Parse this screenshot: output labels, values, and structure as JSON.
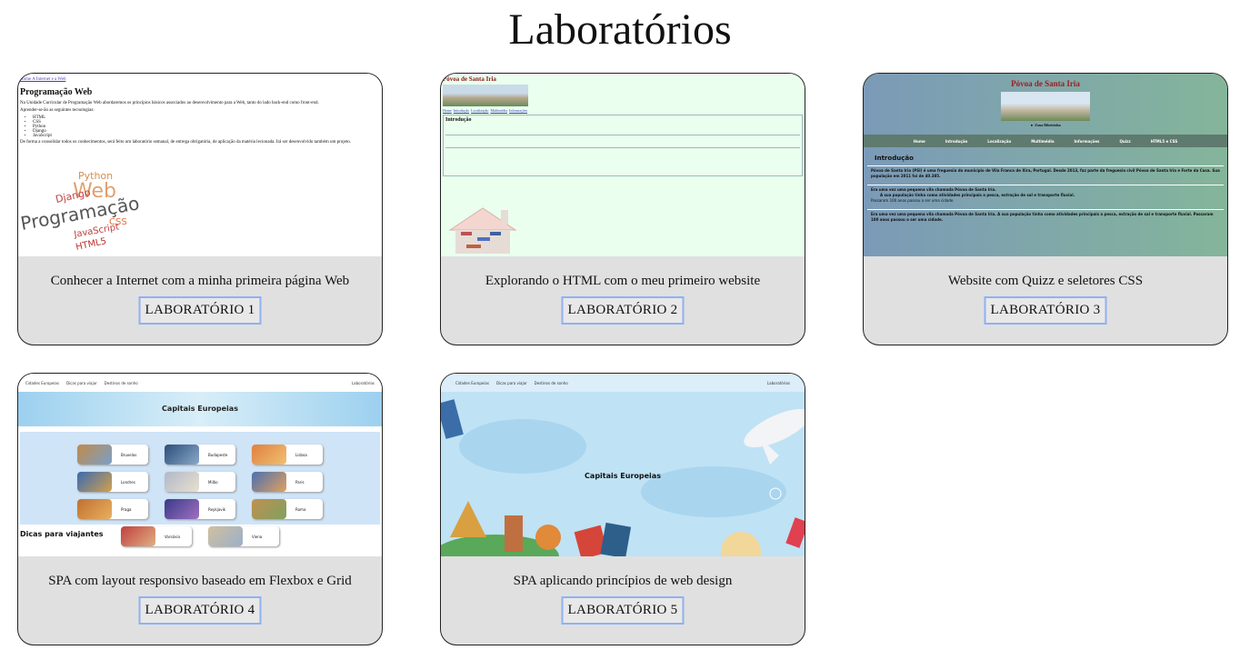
{
  "page": {
    "title": "Laboratórios"
  },
  "labs": [
    {
      "caption": "Conhecer a Internet com a minha primeira página Web",
      "button": "LABORATÓRIO 1",
      "preview": {
        "top_link": "Home A Internet e a Web",
        "heading": "Programação Web",
        "intro": "Na Unidade Curricular de Programação Web abordaremos os princípios básicos associados ao desenvolvimento para a Web, tanto do lado back-end como front-end.",
        "subintro": "Aprender-se-ão as seguintes tecnologias:",
        "items": [
          "HTML",
          "CSS",
          "Python",
          "Django",
          "JavaScript"
        ],
        "outro": "De forma a consolidar todos os conhecimentos, será feito um laboratório semanal, de entrega obrigatória, de aplicação da matéria lecionada. Irá ser desenvolvido também um projeto.",
        "cloud_words": [
          "Python",
          "Web",
          "Django",
          "Programação",
          "CSS",
          "JavaScript",
          "HTML5"
        ]
      }
    },
    {
      "caption": "Explorando o HTML com o meu primeiro website",
      "button": "LABORATÓRIO 2",
      "preview": {
        "heading": "Póvoa de Santa Iria",
        "nav": [
          "Home",
          "Introdução",
          "Localização",
          "Multimédia",
          "Informações"
        ],
        "section": "Introdução"
      }
    },
    {
      "caption": "Website com Quizz e seletores CSS",
      "button": "LABORATÓRIO 3",
      "preview": {
        "heading": "Póvoa de Santa Iria",
        "subtitle": "► Zona Ribeirinha",
        "nav": [
          "Home",
          "Introdução",
          "Localização",
          "Multimédia",
          "Informações",
          "Quizz",
          "HTML5 e CSS"
        ],
        "section": "Introdução",
        "text1": "Póvoa de Santa Iria (PSI) é uma freguesia do município de Vila Franca de Xira, Portugal. Desde 2013, faz parte da freguesia civil Póvoa de Santa Iria e Forte da Casa. Sua população em 2011 foi de 40.385.",
        "text2": "Era uma vez uma pequena vila chamada Póvoa de Santa Iria.",
        "text3": "A sua população tinha como atividades principais a pesca, extração de sal e transporte fluvial.",
        "text4": "Passaram 100 anos passou a ser uma cidade.",
        "text5": "Era uma vez uma pequena vila chamada Póvoa de Santa Iria. A sua população tinha como atividades principais a pesca, extração de sal e transporte fluvial. Passaram 100 anos passou a ser uma cidade."
      }
    },
    {
      "caption": "SPA com layout responsivo baseado em Flexbox e Grid",
      "button": "LABORATÓRIO 4",
      "preview": {
        "nav": [
          "Cidades Europeias",
          "Dicas para viajar",
          "Destinos de sonho"
        ],
        "nav_right": "Laboratórios",
        "banner": "Capitais Europeias",
        "cities": [
          "Bruxelas",
          "Budapeste",
          "Lisboa",
          "Londres",
          "Milão",
          "Paris",
          "Praga",
          "Reykjavik",
          "Roma",
          "Varsóvia",
          "Viena"
        ],
        "section": "Dicas para viajantes"
      }
    },
    {
      "caption": "SPA aplicando princípios de web design",
      "button": "LABORATÓRIO 5",
      "preview": {
        "nav": [
          "Cidades Europeias",
          "Dicas para viajar",
          "Destinos de sonho"
        ],
        "nav_right": "Laboratórios",
        "center": "Capitais Europeias"
      }
    }
  ]
}
